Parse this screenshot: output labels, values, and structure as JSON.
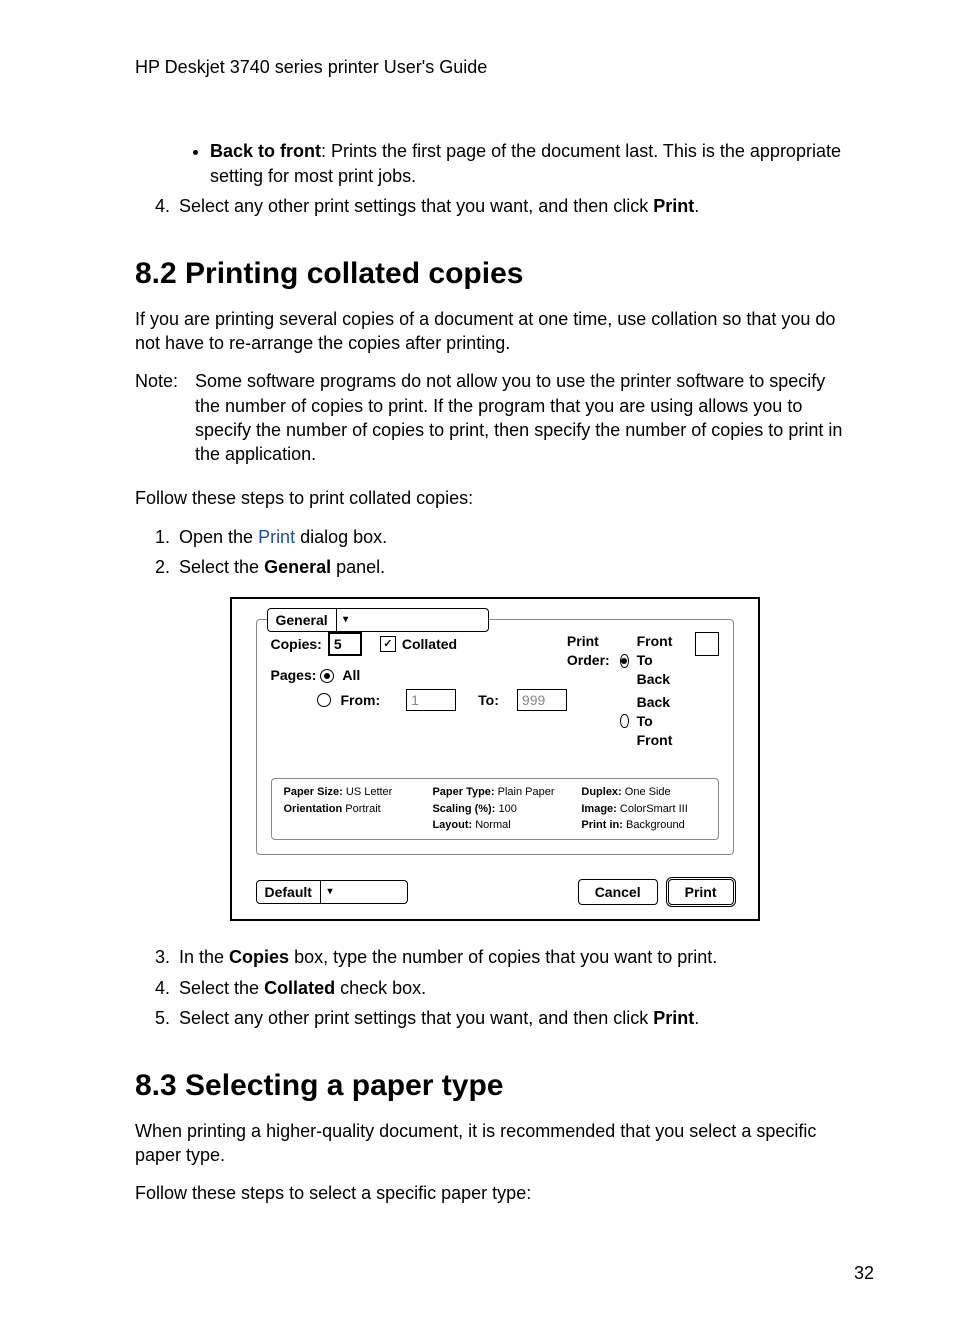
{
  "header": "HP Deskjet 3740 series printer User's Guide",
  "bullet": {
    "back_to_front_label": "Back to front",
    "back_to_front_desc": "Prints the first page of the document last. This is the appropriate setting for most print jobs."
  },
  "step4_top": {
    "prefix": "Select any other print settings that you want, and then click ",
    "print_bold": "Print",
    "suffix": "."
  },
  "section_8_2": {
    "heading": "8.2  Printing collated copies",
    "intro": "If you are printing several copies of a document at one time, use collation so that you do not have to re-arrange the copies after printing.",
    "note_label": "Note:",
    "note_text": "Some software programs do not allow you to use the printer software to specify the number of copies to print. If the program that you are using allows you to specify the number of copies to print, then specify the number of copies to print in the application.",
    "follow": "Follow these steps to print collated copies:",
    "step1_a": "Open the ",
    "step1_link": "Print",
    "step1_b": " dialog box.",
    "step2_a": "Select the ",
    "step2_bold": "General",
    "step2_b": " panel.",
    "step3_a": "In the ",
    "step3_bold": "Copies",
    "step3_b": " box, type the number of copies that you want to print.",
    "step4_a": "Select the ",
    "step4_bold": "Collated",
    "step4_b": " check box.",
    "step5_a": "Select any other print settings that you want, and then click ",
    "step5_bold": "Print",
    "step5_b": "."
  },
  "dialog": {
    "tab": "General",
    "copies_label": "Copies:",
    "copies_value": "5",
    "collated_checked": true,
    "collated_label": "Collated",
    "print_order_label": "Print Order:",
    "front_to_back": "Front To Back",
    "back_to_front": "Back To Front",
    "pages_label": "Pages:",
    "pages_all": "All",
    "pages_from": "From:",
    "from_value": "1",
    "to_label": "To:",
    "to_value": "999",
    "info": {
      "paper_size_k": "Paper Size:",
      "paper_size_v": "US Letter",
      "orientation_k": "Orientation",
      "orientation_v": "Portrait",
      "paper_type_k": "Paper Type:",
      "paper_type_v": "Plain Paper",
      "scaling_k": "Scaling (%):",
      "scaling_v": "100",
      "layout_k": "Layout:",
      "layout_v": "Normal",
      "duplex_k": "Duplex:",
      "duplex_v": "One Side",
      "image_k": "Image:",
      "image_v": "ColorSmart III",
      "print_in_k": "Print in:",
      "print_in_v": "Background"
    },
    "default_button": "Default",
    "cancel_button": "Cancel",
    "print_button": "Print"
  },
  "section_8_3": {
    "heading": "8.3  Selecting a paper type",
    "intro": "When printing a higher-quality document, it is recommended that you select a specific paper type.",
    "follow": "Follow these steps to select a specific paper type:"
  },
  "page_number": "32"
}
